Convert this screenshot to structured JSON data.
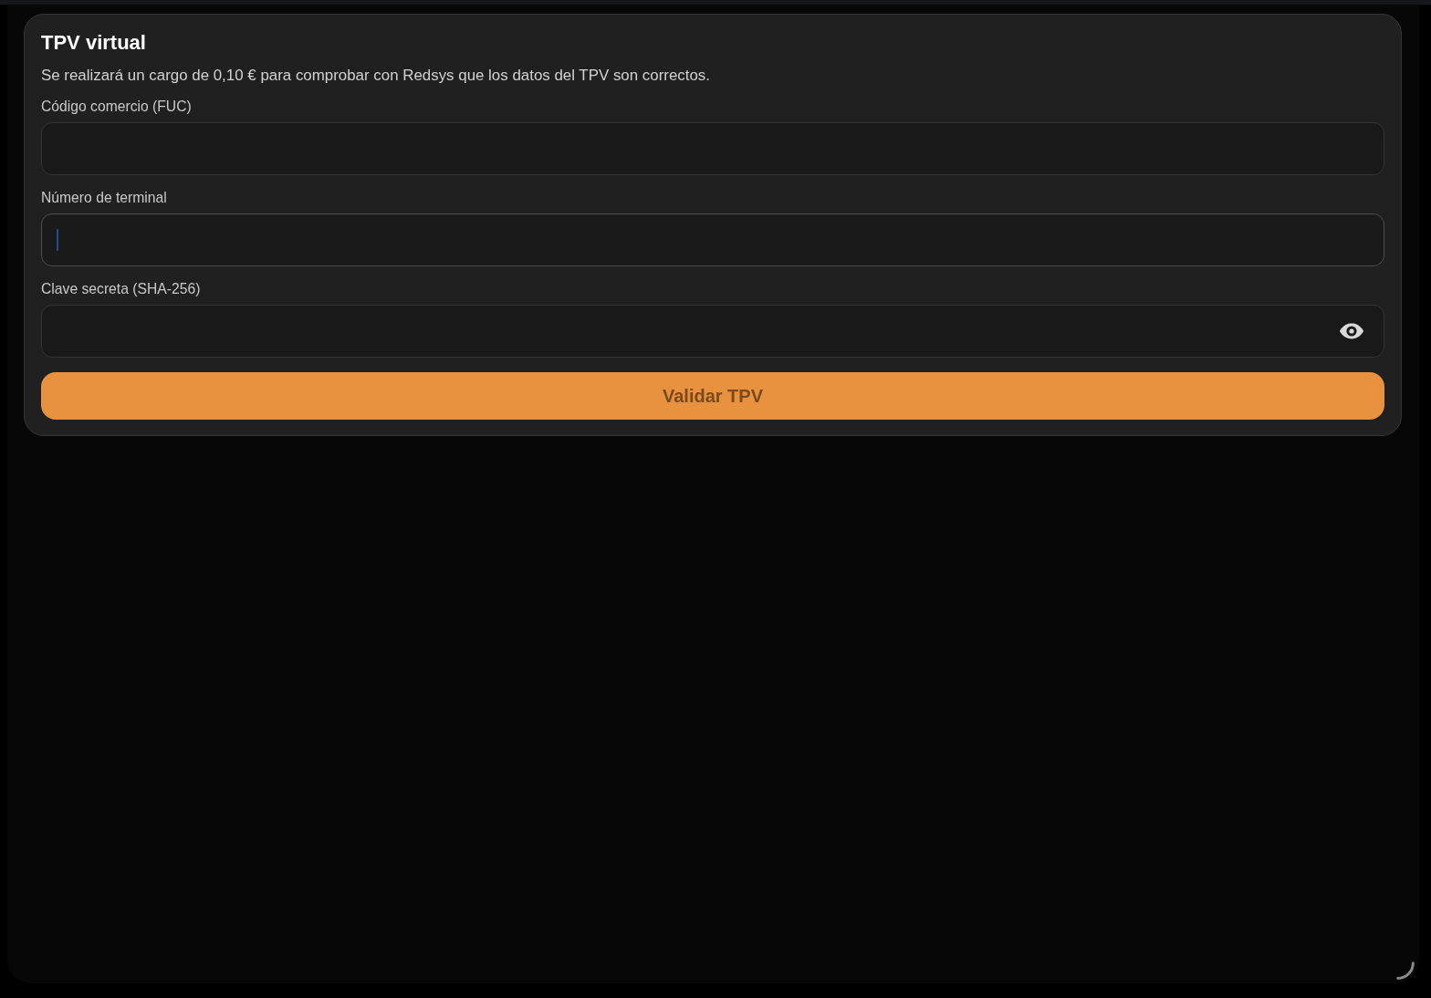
{
  "card": {
    "title": "TPV virtual",
    "description": "Se realizará un cargo de 0,10 € para comprobar con Redsys que los datos del TPV son correctos.",
    "fields": [
      {
        "kind": "text",
        "label": "Código comercio (FUC)",
        "focused": false
      },
      {
        "kind": "text",
        "label": "Número de terminal",
        "focused": true
      },
      {
        "kind": "password",
        "label": "Clave secreta (SHA-256)",
        "focused": false
      }
    ],
    "submit_button": {
      "label": "Validar TPV"
    }
  },
  "loading": true
}
